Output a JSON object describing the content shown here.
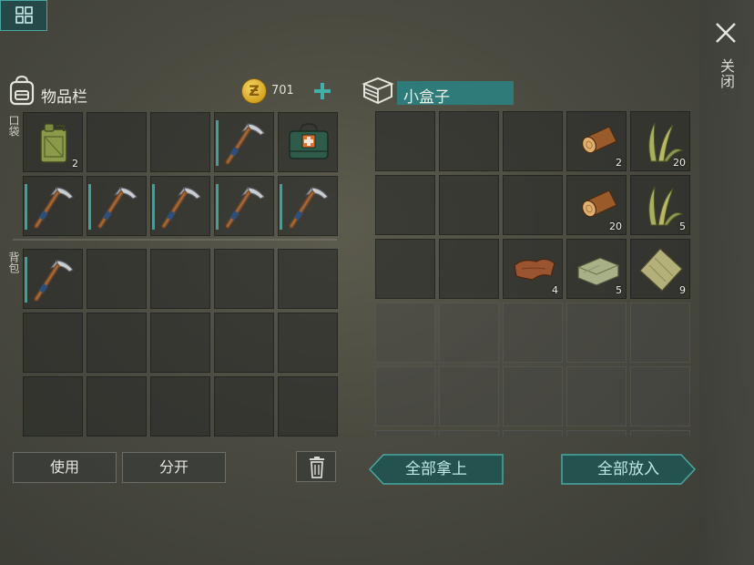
{
  "close": {
    "label": "关闭"
  },
  "inventory": {
    "title": "物品栏",
    "coins": "701",
    "pocket_label": "口袋",
    "backpack_label": "背包",
    "pocket_row1": [
      {
        "icon": "jerrycan-icon",
        "count": "2"
      },
      {
        "icon": "empty",
        "count": ""
      },
      {
        "icon": "empty",
        "count": ""
      },
      {
        "icon": "pickaxe-icon",
        "count": ""
      },
      {
        "icon": "medkit-icon",
        "count": ""
      }
    ],
    "pocket_row2": [
      {
        "icon": "pickaxe-icon",
        "count": ""
      },
      {
        "icon": "pickaxe-icon",
        "count": ""
      },
      {
        "icon": "pickaxe-icon",
        "count": ""
      },
      {
        "icon": "pickaxe-icon",
        "count": ""
      },
      {
        "icon": "pickaxe-icon",
        "count": ""
      }
    ],
    "use_label": "使用",
    "split_label": "分开"
  },
  "box": {
    "title": "小盒子",
    "row1": [
      {
        "icon": "empty",
        "count": ""
      },
      {
        "icon": "empty",
        "count": ""
      },
      {
        "icon": "empty",
        "count": ""
      },
      {
        "icon": "log-icon",
        "count": "2"
      },
      {
        "icon": "grass-icon",
        "count": "20"
      }
    ],
    "row2": [
      {
        "icon": "empty",
        "count": ""
      },
      {
        "icon": "empty",
        "count": ""
      },
      {
        "icon": "empty",
        "count": ""
      },
      {
        "icon": "log-icon",
        "count": "20"
      },
      {
        "icon": "grass-icon",
        "count": "5"
      }
    ],
    "row3": [
      {
        "icon": "empty",
        "count": ""
      },
      {
        "icon": "empty",
        "count": ""
      },
      {
        "icon": "leather-icon",
        "count": "4"
      },
      {
        "icon": "cloth-icon",
        "count": "5"
      },
      {
        "icon": "fabric-scrap-icon",
        "count": "9"
      }
    ],
    "take_all_label": "全部拿上",
    "put_all_label": "全部放入"
  },
  "colors": {
    "accent_teal": "#3aa3a0",
    "title_bar": "#2f7b7a",
    "coin_gold": "#e8b830"
  }
}
